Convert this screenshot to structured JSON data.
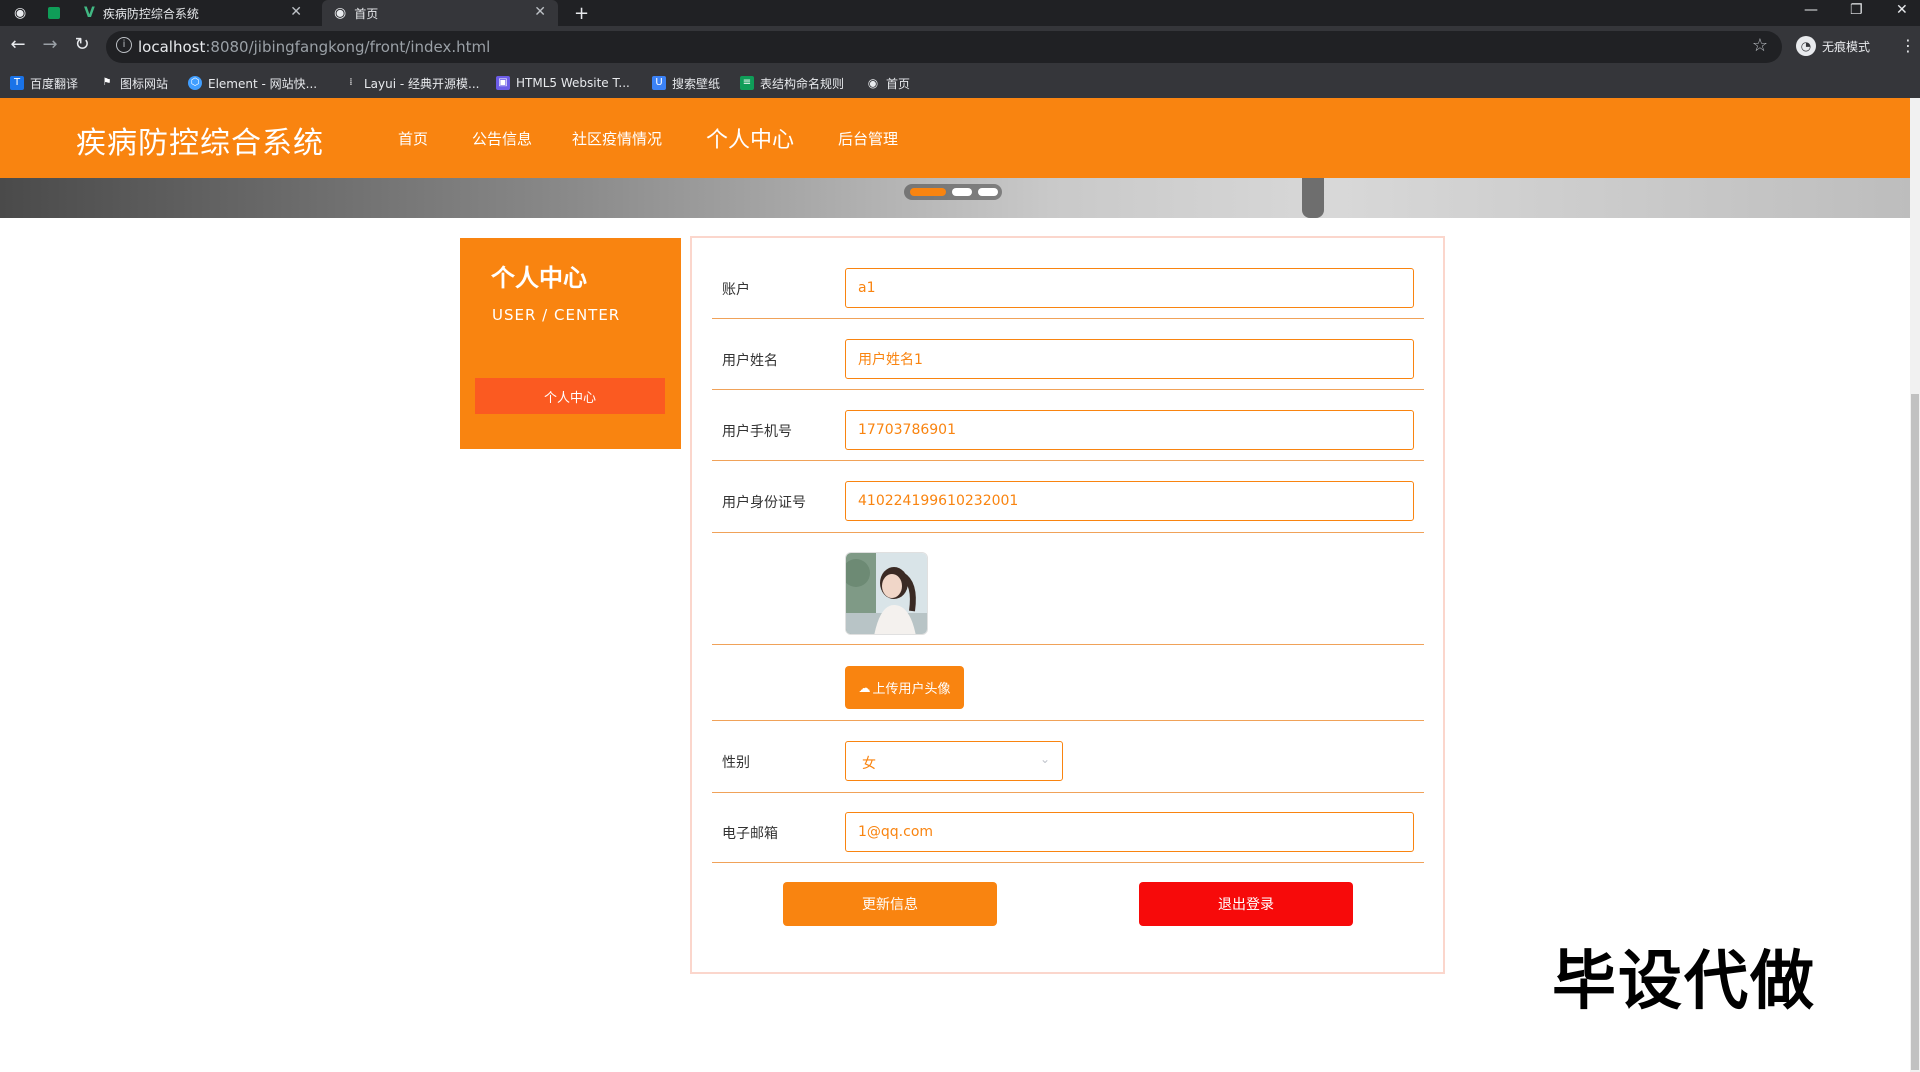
{
  "browser": {
    "tabs": [
      {
        "title": ""
      },
      {
        "title": ""
      },
      {
        "title": "疾病防控综合系统"
      },
      {
        "title": "首页"
      }
    ],
    "url_host": "localhost",
    "url_rest": ":8080/jibingfangkong/front/index.html",
    "incognito_label": "无痕模式",
    "bookmarks": [
      {
        "label": "百度翻译",
        "color": "#1a73e8"
      },
      {
        "label": "图标网站",
        "color": "#202124"
      },
      {
        "label": "Element - 网站快...",
        "color": "#409eff"
      },
      {
        "label": "Layui - 经典开源模...",
        "color": "#5f6368"
      },
      {
        "label": "HTML5 Website T...",
        "color": "#6c5ce7"
      },
      {
        "label": "搜索壁纸",
        "color": "#3b82f6"
      },
      {
        "label": "表结构命名规则",
        "color": "#0f9d58"
      },
      {
        "label": "首页",
        "color": "#e8eaed"
      }
    ]
  },
  "header": {
    "site_title": "疾病防控综合系统",
    "nav": [
      "首页",
      "公告信息",
      "社区疫情情况",
      "个人中心",
      "后台管理"
    ],
    "active_nav": "个人中心"
  },
  "sidebar": {
    "title": "个人中心",
    "subtitle": "USER / CENTER",
    "menu": [
      "个人中心"
    ]
  },
  "form": {
    "fields": [
      {
        "label": "账户",
        "value": "a1"
      },
      {
        "label": "用户姓名",
        "value": "用户姓名1"
      },
      {
        "label": "用户手机号",
        "value": "17703786901"
      },
      {
        "label": "用户身份证号",
        "value": "410224199610232001"
      }
    ],
    "upload_label": "上传用户头像",
    "gender": {
      "label": "性别",
      "value": "女"
    },
    "email": {
      "label": "电子邮箱",
      "value": "1@qq.com"
    },
    "update_label": "更新信息",
    "logout_label": "退出登录"
  },
  "watermark": "毕设代做",
  "colors": {
    "primary": "#f98410",
    "danger": "#f70a0a",
    "sidebar_button": "#fb5a21"
  }
}
